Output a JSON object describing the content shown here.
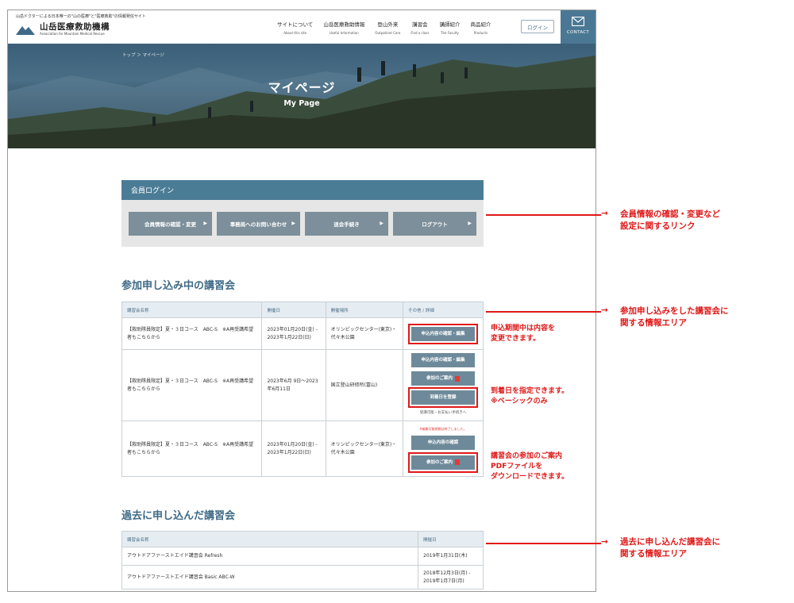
{
  "header": {
    "tagline": "山岳ドクターによる日本唯一の\"山の医療\"と\"医療救助\"の情報発信サイト",
    "logo_jp": "山岳医療救助機構",
    "logo_en": "Association for Mountain Medical Rescue",
    "nav": [
      {
        "jp": "サイトについて",
        "en": "About this site"
      },
      {
        "jp": "山岳医療救助情報",
        "en": "Useful Information"
      },
      {
        "jp": "登山外来",
        "en": "Outpatient Care"
      },
      {
        "jp": "講習会",
        "en": "Find a class"
      },
      {
        "jp": "講師紹介",
        "en": "The Faculty"
      },
      {
        "jp": "商品紹介",
        "en": "Products"
      }
    ],
    "login": "ログイン",
    "contact": "CONTACT"
  },
  "hero": {
    "breadcrumb": "トップ ＞ マイページ",
    "title": "マイページ",
    "subtitle": "My Page"
  },
  "member": {
    "title": "会員ログイン",
    "buttons": [
      "会員情報の確認・変更",
      "事務局へのお問い合わせ",
      "退会手続き",
      "ログアウト"
    ]
  },
  "current": {
    "title": "参加申し込み中の講習会",
    "headers": [
      "講習会名称",
      "開催日",
      "開催場所",
      "その他 / 詳細"
    ],
    "rows": [
      {
        "name": "【救助隊員限定】夏・３日コース　ABC-S　※A再受講希望者もこちらから",
        "date": "2023年01月20日(金) - 2023年1月22日(日)",
        "place": "オリンピックセンター(東京)・代々木公園"
      },
      {
        "name": "【救助隊員限定】夏・３日コース　ABC-S　※A再受講希望者もこちらから",
        "date": "2023年6月 9日〜2023年6月11日",
        "place": "国立登山研修所(富山)"
      },
      {
        "name": "【救助隊員限定】夏・３日コース　ABC-S　※A再受講希望者もこちらから",
        "date": "2023年01月20日(金) - 2023年1月22日(日)",
        "place": "オリンピックセンター(東京)・代々木公園"
      }
    ],
    "btn_edit": "申込内容の確認・編集",
    "btn_guide": "参加のご案内",
    "btn_arrival": "到着日を登録",
    "arrival_note": "受講可能・お支払い手続きへ",
    "closed_note": "※編集可能期間は終了しました。",
    "btn_confirm": "申込内容の確認"
  },
  "past": {
    "title": "過去に申し込んだ講習会",
    "headers": [
      "講習会名称",
      "開催日"
    ],
    "rows": [
      {
        "name": "アウトドアファーストエイド講習会 Refresh",
        "date": "2019年1月31日(木)"
      },
      {
        "name": "アウトドアファーストエイド講習会 Basic ABC-W",
        "date": "2018年12月3日(月) - 2019年1月7日(月)"
      }
    ]
  },
  "annotations": {
    "a1": [
      "会員情報の確認・変更など",
      "設定に関するリンク"
    ],
    "a2": [
      "参加申し込みをした講習会に",
      "関する情報エリア"
    ],
    "a3": [
      "申込期間中は内容を",
      "変更できます。"
    ],
    "a4": [
      "到着日を指定できます。",
      "※ベーシックのみ"
    ],
    "a5": [
      "講習会の参加のご案内",
      "PDFファイルを",
      "ダウンロードできます。"
    ],
    "a6": [
      "過去に申し込んだ講習会に",
      "関する情報エリア"
    ]
  },
  "colors": {
    "accent": "#4b7c96",
    "annotation": "#e01818",
    "button": "#7c8f9a"
  }
}
